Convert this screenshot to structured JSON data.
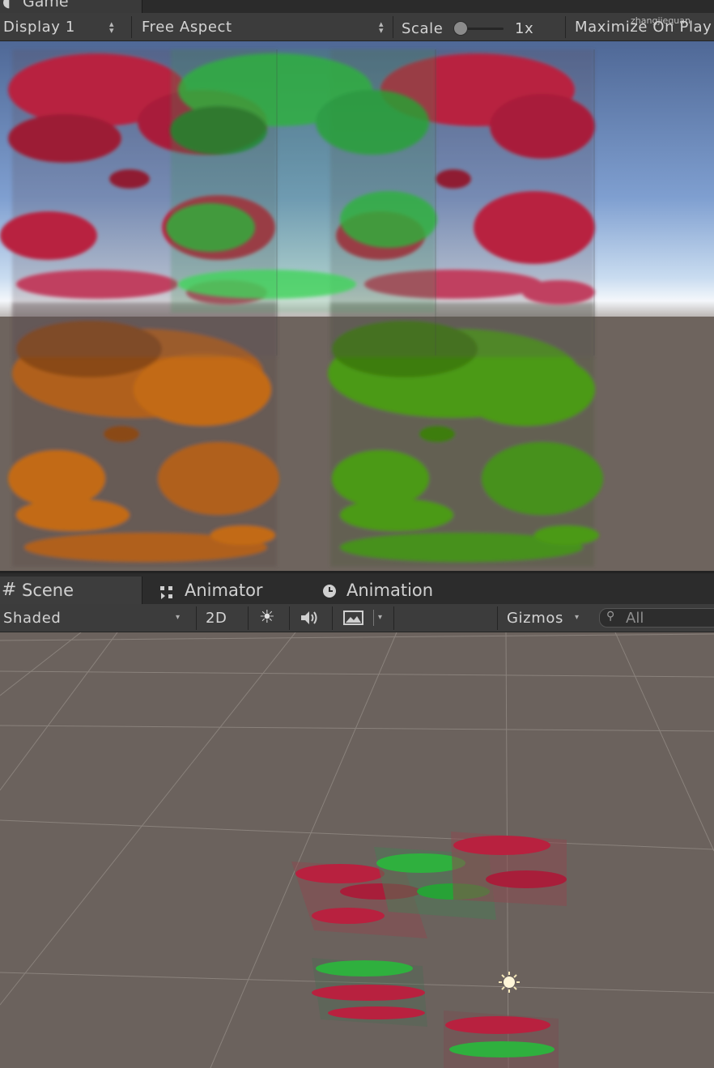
{
  "game_tab": {
    "label": "Game"
  },
  "game_toolbar": {
    "display": "Display 1",
    "aspect": "Free Aspect",
    "scale_label": "Scale",
    "scale_value": "1x",
    "maximize": "Maximize On Play",
    "watermark": "zhangjiequan"
  },
  "scene_tabs": [
    {
      "label": "Scene",
      "icon": "hash-icon"
    },
    {
      "label": "Animator",
      "icon": "animator-icon"
    },
    {
      "label": "Animation",
      "icon": "clock-icon"
    }
  ],
  "scene_toolbar": {
    "shading": "Shaded",
    "mode_2d": "2D",
    "gizmos": "Gizmos",
    "search_placeholder": "All"
  },
  "colors": {
    "cloud_red": "#b8213f",
    "cloud_green": "#2fb03e",
    "cloud_orange": "#c26a16",
    "cloud_lime": "#4c9a14",
    "floor": "#6e645e",
    "sky_top": "#4f6896"
  }
}
